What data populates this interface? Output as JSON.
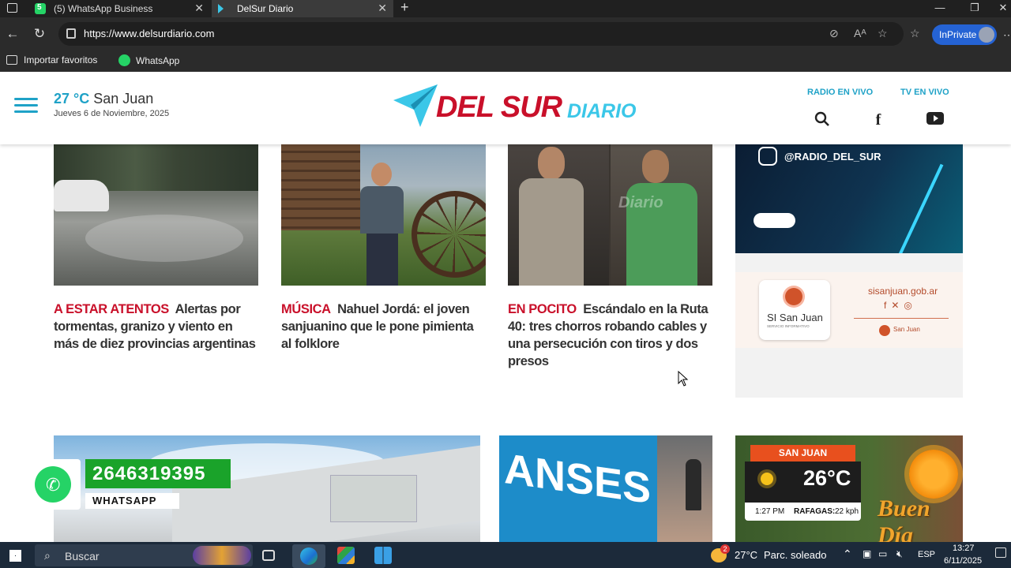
{
  "browser": {
    "tabs": [
      {
        "label": "(5) WhatsApp Business",
        "badge": "5"
      },
      {
        "label": "DelSur Diario"
      }
    ],
    "url": "https://www.delsurdiario.com",
    "inprivate_label": "InPrivate",
    "favorites": [
      {
        "label": "Importar favoritos"
      },
      {
        "label": "WhatsApp"
      }
    ]
  },
  "site": {
    "temp_value": "27 °C",
    "city": "San Juan",
    "date": "Jueves 6 de Noviembre, 2025",
    "logo_main": "DEL SUR",
    "logo_sub": "DIARIO",
    "radio_label": "RADIO EN VIVO",
    "tv_label": "TV EN VIVO",
    "brand_color": "#c9102a",
    "accent_color": "#1fa2c7"
  },
  "articles": [
    {
      "kicker": "A ESTAR ATENTOS",
      "title": "Alertas por tormentas, granizo y viento en más de diez provincias argentinas"
    },
    {
      "kicker": "MÚSICA",
      "title": "Nahuel Jordá: el joven sanjuanino que le pone pimienta al folklore"
    },
    {
      "kicker": "EN POCITO",
      "title": "Escándalo en la Ruta 40: tres chorros robando cables y una persecución con tiros y dos presos"
    }
  ],
  "image_texts": {
    "photo_watermark": "Diario",
    "anses": "ANSES"
  },
  "ads": {
    "radio_handle": "@RADIO_DEL_SUR",
    "si_sanjuan_brand": "SI San Juan",
    "si_sanjuan_tagline": "SERVICIO INFORMATIVO",
    "si_sanjuan_url": "sisanjuan.gob.ar",
    "san_juan_logo_text": "San Juan"
  },
  "whatsapp_widget": {
    "phone": "2646319395",
    "label": "WHATSAPP"
  },
  "weather_widget": {
    "city": "SAN JUAN",
    "temp": "26°C",
    "time": "1:27 PM",
    "gusts_label": "RAFAGAS:",
    "gusts_value": "22 kph",
    "greeting": "Buen Día"
  },
  "taskbar": {
    "search_placeholder": "Buscar",
    "weather_badge": "2",
    "weather": "27°C",
    "weather_desc": "Parc. soleado",
    "lang": "ESP",
    "time": "13:27",
    "date": "6/11/2025"
  }
}
